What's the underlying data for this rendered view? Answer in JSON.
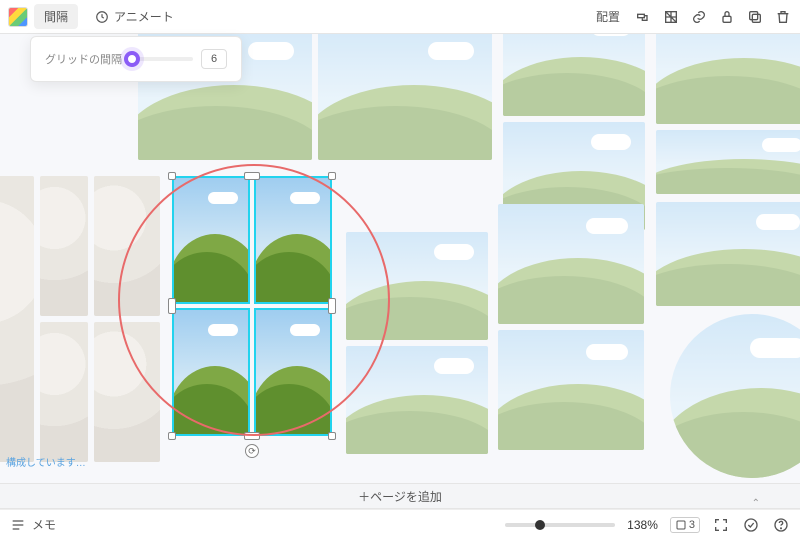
{
  "toolbar": {
    "spacing_tab": "間隔",
    "animate_label": "アニメート",
    "position_label": "配置"
  },
  "popover": {
    "label": "グリッドの間隔",
    "value": "6"
  },
  "canvas": {
    "status_text": "構成しています…"
  },
  "add_page": {
    "label": "＋ページを追加"
  },
  "bottom": {
    "memo_label": "メモ",
    "zoom_pct": "138%",
    "page_indicator": "3"
  }
}
